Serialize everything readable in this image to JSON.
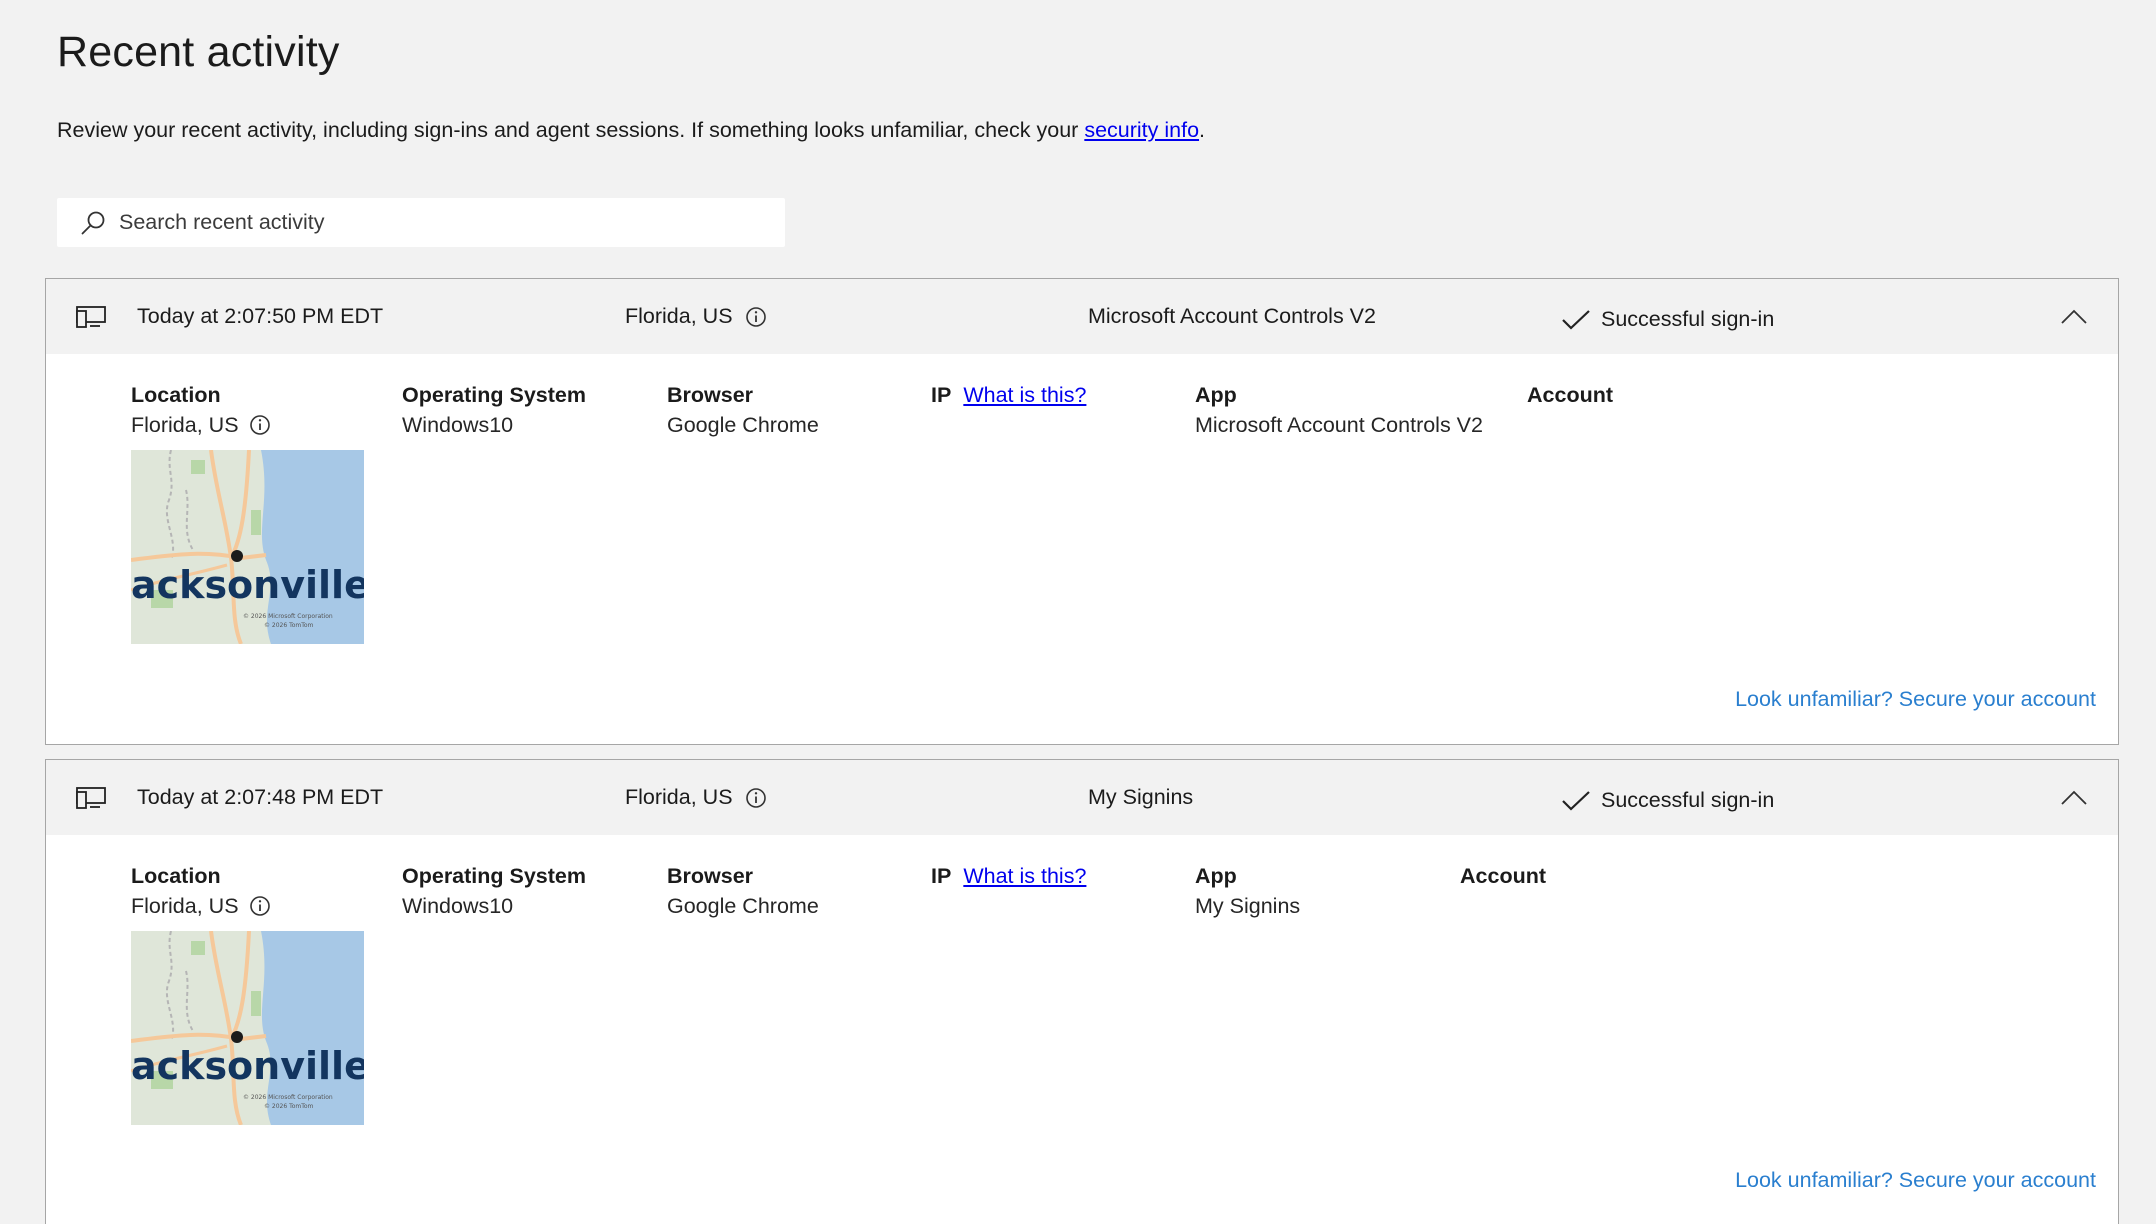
{
  "page": {
    "title": "Recent activity",
    "intro_text": "Review your recent activity, including sign-ins and agent sessions. If something looks unfamiliar, check your ",
    "intro_link": "security info",
    "intro_end": "."
  },
  "search": {
    "placeholder": "Search recent activity",
    "value": ""
  },
  "labels": {
    "location": "Location",
    "os": "Operating System",
    "browser": "Browser",
    "ip": "IP",
    "ip_help": "What is this?",
    "app": "App",
    "account": "Account",
    "secure": "Look unfamiliar? Secure your account"
  },
  "activities": [
    {
      "time": "Today at 2:07:50 PM EDT",
      "location": "Florida, US",
      "app": "Microsoft Account Controls V2",
      "status": "Successful sign-in",
      "os": "Windows10",
      "browser": "Google Chrome",
      "map_city": "acksonville",
      "map_credit_1": "© 2026 Microsoft Corporation",
      "map_credit_2": "© 2026 TomTom"
    },
    {
      "time": "Today at 2:07:48 PM EDT",
      "location": "Florida, US",
      "app": "My Signins",
      "status": "Successful sign-in",
      "os": "Windows10",
      "browser": "Google Chrome",
      "map_city": "acksonville",
      "map_credit_1": "© 2026 Microsoft Corporation",
      "map_credit_2": "© 2026 TomTom"
    }
  ],
  "colors": {
    "link": "#0000ee",
    "secure_link": "#2a7fcf",
    "header_bg": "#f2f2f2",
    "water": "#a7c8e6"
  },
  "icons": [
    "search-icon",
    "desktop-icon",
    "info-icon",
    "checkmark-icon",
    "chevron-up-icon",
    "location-pin-icon"
  ]
}
